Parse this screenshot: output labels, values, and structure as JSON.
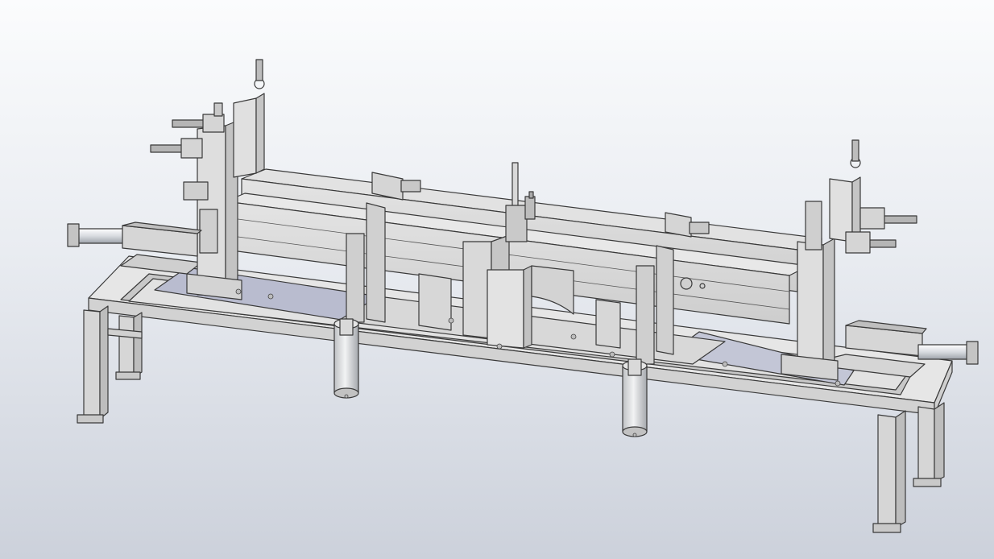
{
  "viewport": {
    "background_top": "#fbfcfd",
    "background_bottom": "#ccd1db"
  },
  "model": {
    "part_fill": "#dcdcdc",
    "part_shade": "#c4c4c4",
    "part_dark": "#a9a9a9",
    "edge_color": "#3a3a3a",
    "plate_accent": "#b9bccf",
    "rod_color": "#eef0f3"
  }
}
